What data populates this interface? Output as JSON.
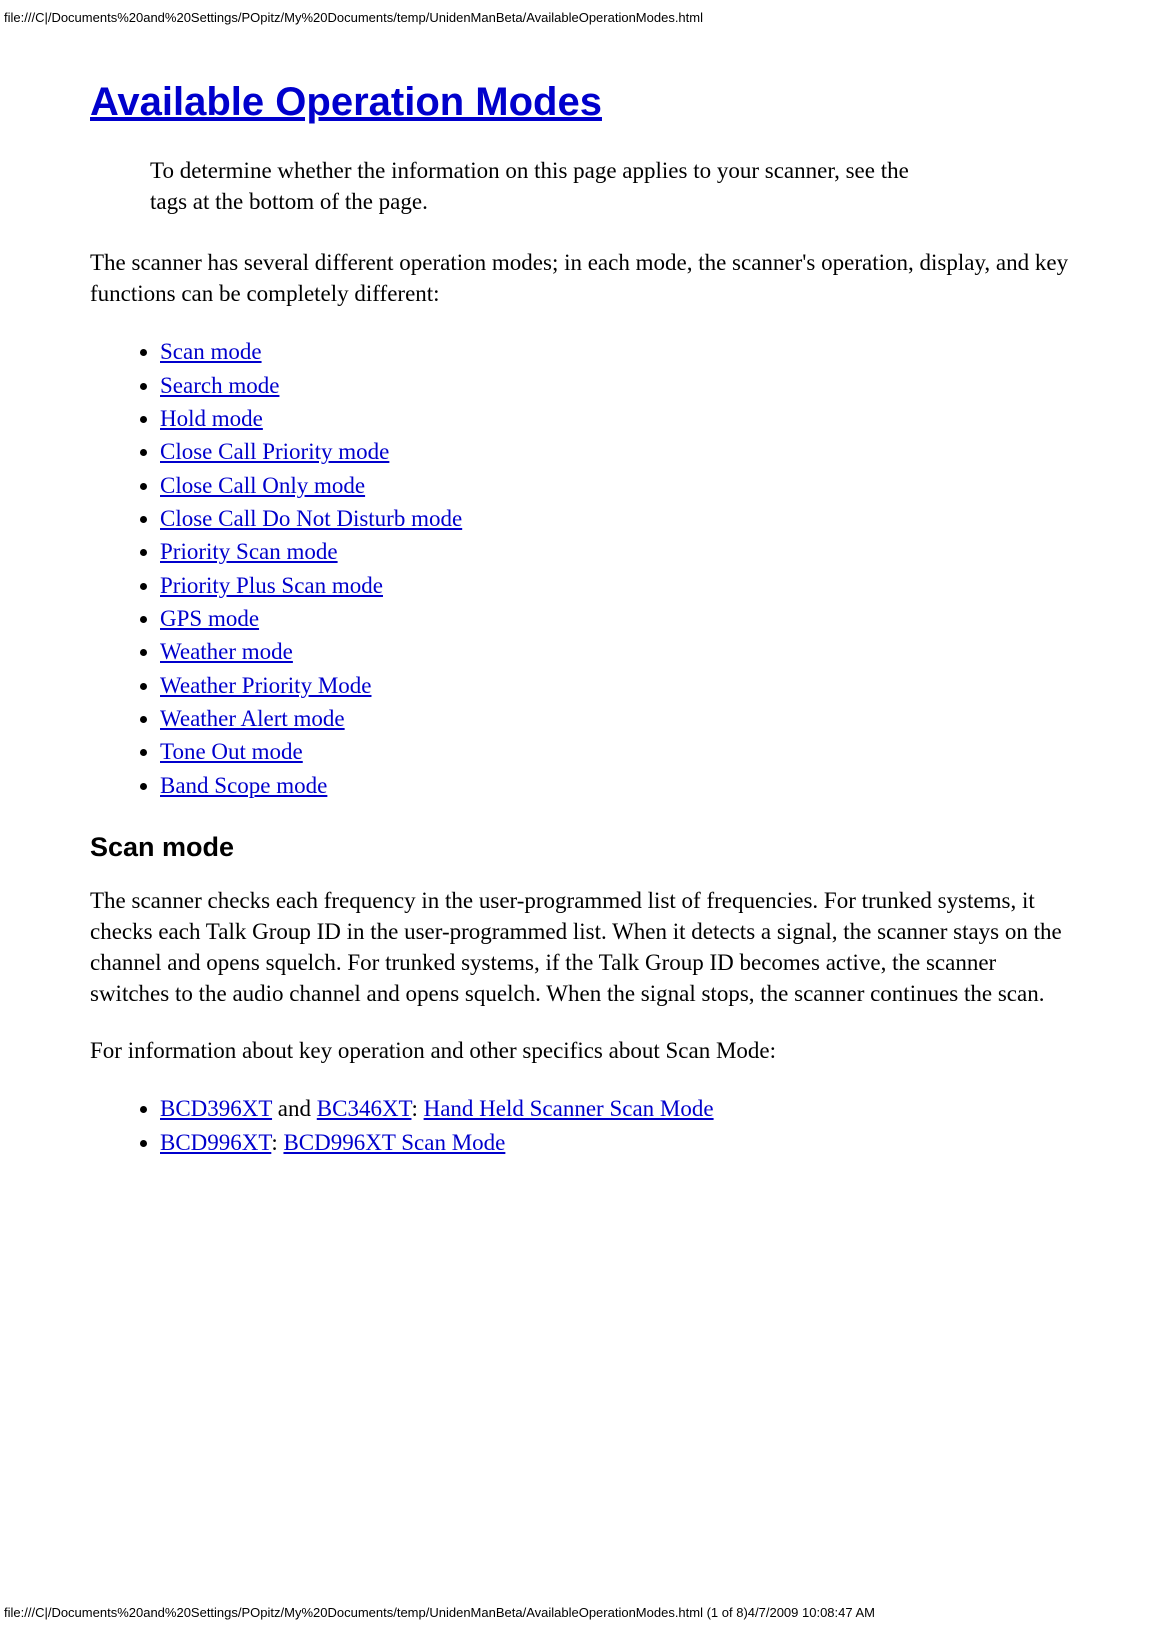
{
  "header_path": "file:///C|/Documents%20and%20Settings/POpitz/My%20Documents/temp/UnidenManBeta/AvailableOperationModes.html",
  "title": "Available Operation Modes",
  "note": "To determine whether the information on this page applies to your scanner, see the tags at the bottom of the page.",
  "intro": "The scanner has several different operation modes; in each mode, the scanner's operation, display, and key functions can be completely different:",
  "modes": [
    "Scan mode",
    "Search mode",
    "Hold mode",
    "Close Call Priority mode",
    "Close Call Only mode",
    "Close Call Do Not Disturb mode",
    "Priority Scan mode",
    "Priority Plus Scan mode",
    "GPS mode",
    "Weather mode",
    "Weather Priority Mode",
    "Weather Alert mode",
    "Tone Out mode",
    "Band Scope mode"
  ],
  "section_title": "Scan mode",
  "section_p1": "The scanner checks each frequency in the user-programmed list of frequencies. For trunked systems, it checks each Talk Group ID in the user-programmed list. When it detects a signal, the scanner stays on the channel and opens squelch. For trunked systems, if the Talk Group ID becomes active, the scanner switches to the audio channel and opens squelch. When the signal stops, the scanner continues the scan.",
  "section_p2": "For information about key operation and other specifics about Scan Mode:",
  "refs": {
    "bcd396xt": "BCD396XT",
    "and": " and ",
    "bc346xt": "BC346XT",
    "colon": ": ",
    "handheld": "Hand Held Scanner Scan Mode",
    "bcd996xt": "BCD996XT",
    "bcd996xt_mode": "BCD996XT Scan Mode"
  },
  "footer_path": "file:///C|/Documents%20and%20Settings/POpitz/My%20Documents/temp/UnidenManBeta/AvailableOperationModes.html (1 of 8)4/7/2009 10:08:47 AM"
}
